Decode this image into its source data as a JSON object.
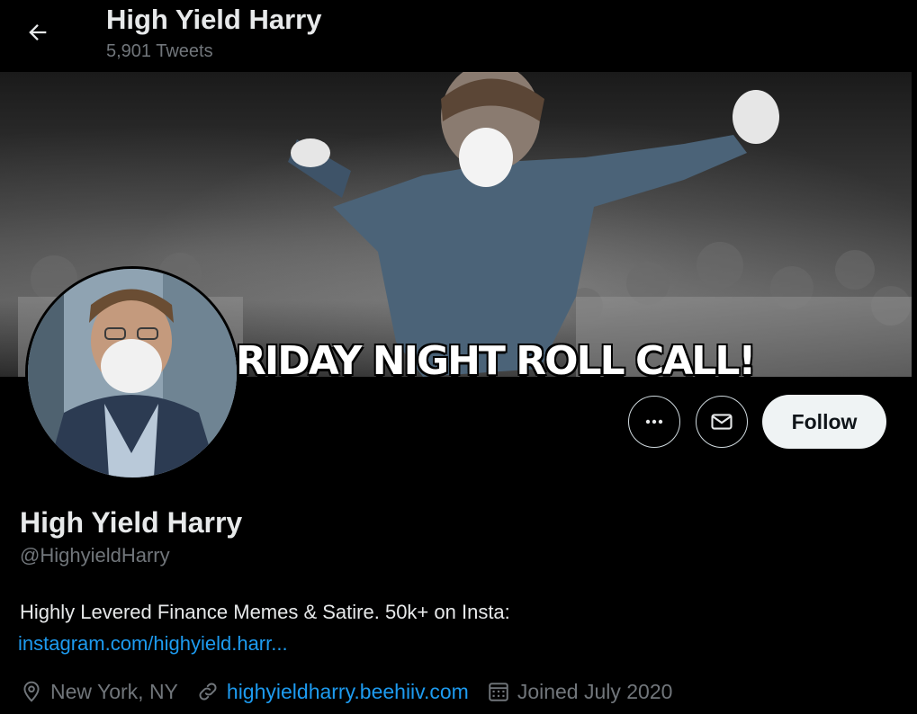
{
  "header": {
    "title": "High Yield Harry",
    "tweet_count": "5,901 Tweets"
  },
  "banner": {
    "caption": "RIDAY NIGHT ROLL CALL!"
  },
  "actions": {
    "follow_label": "Follow"
  },
  "profile": {
    "name": "High Yield Harry",
    "handle": "@HighyieldHarry",
    "bio": "Highly Levered Finance Memes & Satire. 50k+ on Insta:",
    "bio_link": "instagram.com/highyield.harr...",
    "location": "New York, NY",
    "website": "highyieldharry.beehiiv.com",
    "joined": "Joined July 2020"
  },
  "colors": {
    "background": "#000000",
    "text": "#e7e9ea",
    "muted": "#71767b",
    "link": "#1d9bf0",
    "follow_bg": "#eff3f4"
  },
  "icons": [
    "back-arrow-icon",
    "more-icon",
    "mail-icon",
    "location-icon",
    "link-icon",
    "calendar-icon"
  ]
}
